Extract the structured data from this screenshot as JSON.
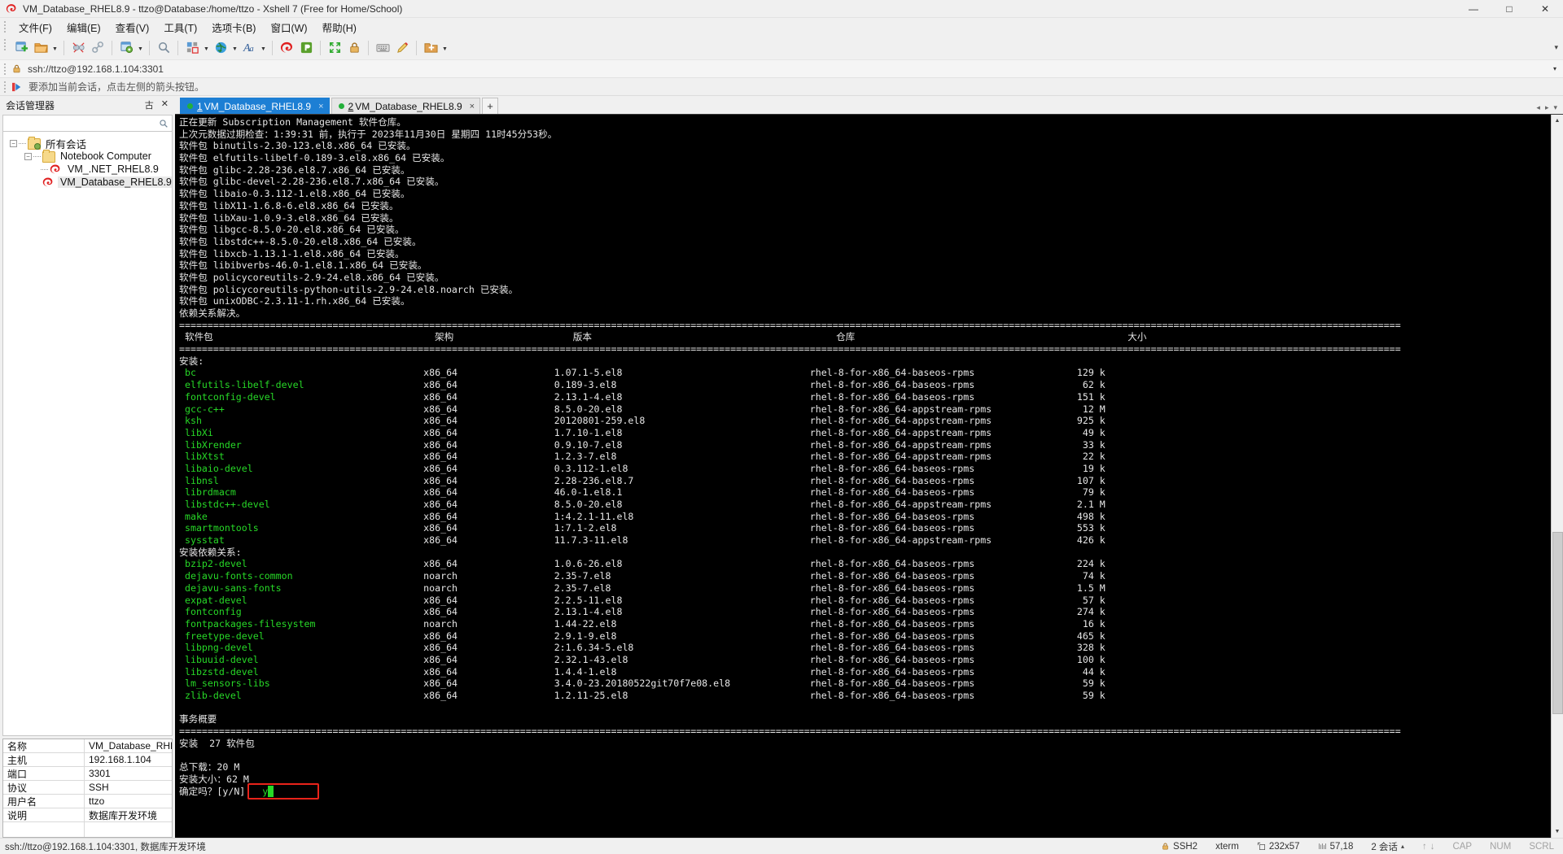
{
  "window": {
    "title": "VM_Database_RHEL8.9 - ttzo@Database:/home/ttzo - Xshell 7 (Free for Home/School)",
    "minimize": "—",
    "maximize": "□",
    "close": "✕"
  },
  "menu": {
    "items": [
      "文件(F)",
      "编辑(E)",
      "查看(V)",
      "工具(T)",
      "选项卡(B)",
      "窗口(W)",
      "帮助(H)"
    ]
  },
  "toolbar": {
    "items": [
      {
        "name": "new-session-icon"
      },
      {
        "name": "open-folder-icon",
        "caret": true
      },
      {
        "sep": true
      },
      {
        "name": "disconnect-icon"
      },
      {
        "name": "link-icon"
      },
      {
        "sep": true
      },
      {
        "name": "session-properties-icon",
        "caret": true
      },
      {
        "sep": true
      },
      {
        "name": "find-icon"
      },
      {
        "sep": true
      },
      {
        "name": "layout-icon",
        "caret": true
      },
      {
        "name": "globe-icon",
        "caret": true
      },
      {
        "name": "font-icon",
        "caret": true
      },
      {
        "sep": true
      },
      {
        "name": "xshell-icon"
      },
      {
        "name": "xftp-icon"
      },
      {
        "sep": true
      },
      {
        "name": "fullscreen-icon"
      },
      {
        "name": "lock-icon"
      },
      {
        "sep": true
      },
      {
        "name": "keyboard-icon"
      },
      {
        "name": "highlight-icon"
      },
      {
        "sep": true
      },
      {
        "name": "add-folder-icon",
        "caret": true
      }
    ],
    "overflow": "▾"
  },
  "address": {
    "lock_icon": "lock-icon",
    "url": "ssh://ttzo@192.168.1.104:3301",
    "dropdown": "▾"
  },
  "hint": {
    "icon": "red-arrow-icon",
    "text": "要添加当前会话，点击左侧的箭头按钮。"
  },
  "sidebar": {
    "title": "会话管理器",
    "pin_icon": "古",
    "close_icon": "✕",
    "search": {
      "value": "",
      "placeholder": ""
    },
    "tree": [
      {
        "label": "所有会话",
        "level": 0,
        "type": "folder-root",
        "expander": "−"
      },
      {
        "label": "Notebook Computer",
        "level": 1,
        "type": "folder",
        "expander": "−"
      },
      {
        "label": "VM_.NET_RHEL8.9",
        "level": 2,
        "type": "session",
        "expander": ""
      },
      {
        "label": "VM_Database_RHEL8.9",
        "level": 2,
        "type": "session",
        "expander": "",
        "selected": true
      }
    ],
    "properties": [
      {
        "key": "名称",
        "value": "VM_Database_RHE..."
      },
      {
        "key": "主机",
        "value": "192.168.1.104"
      },
      {
        "key": "端口",
        "value": "3301"
      },
      {
        "key": "协议",
        "value": "SSH"
      },
      {
        "key": "用户名",
        "value": "ttzo"
      },
      {
        "key": "说明",
        "value": "数据库开发环境"
      },
      {
        "key": "",
        "value": ""
      }
    ]
  },
  "tabs": {
    "items": [
      {
        "num": "1",
        "label": "VM_Database_RHEL8.9",
        "active": true,
        "close": "×"
      },
      {
        "num": "2",
        "label": "VM_Database_RHEL8.9",
        "active": false,
        "close": "×"
      }
    ],
    "add_label": "+",
    "nav_left": "◂",
    "nav_right": "▸",
    "nav_menu": "▾"
  },
  "terminal": {
    "header_lines": [
      "正在更新 Subscription Management 软件仓库。",
      "上次元数据过期检查：1:39:31 前，执行于 2023年11月30日 星期四 11时45分53秒。",
      "软件包 binutils-2.30-123.el8.x86_64 已安装。",
      "软件包 elfutils-libelf-0.189-3.el8.x86_64 已安装。",
      "软件包 glibc-2.28-236.el8.7.x86_64 已安装。",
      "软件包 glibc-devel-2.28-236.el8.7.x86_64 已安装。",
      "软件包 libaio-0.3.112-1.el8.x86_64 已安装。",
      "软件包 libX11-1.6.8-6.el8.x86_64 已安装。",
      "软件包 libXau-1.0.9-3.el8.x86_64 已安装。",
      "软件包 libgcc-8.5.0-20.el8.x86_64 已安装。",
      "软件包 libstdc++-8.5.0-20.el8.x86_64 已安装。",
      "软件包 libxcb-1.13.1-1.el8.x86_64 已安装。",
      "软件包 libibverbs-46.0-1.el8.1.x86_64 已安装。",
      "软件包 policycoreutils-2.9-24.el8.x86_64 已安装。",
      "软件包 policycoreutils-python-utils-2.9-24.el8.noarch 已安装。",
      "软件包 unixODBC-2.3.11-1.rh.x86_64 已安装。",
      "依赖关系解决。"
    ],
    "table_header": {
      "package": "软件包",
      "arch": "架构",
      "version": "版本",
      "repo": "仓库",
      "size": "大小"
    },
    "section_install": "安装:",
    "section_deps": "安装依赖关系:",
    "install_rows": [
      {
        "pkg": "bc",
        "arch": "x86_64",
        "ver": "1.07.1-5.el8",
        "repo": "rhel-8-for-x86_64-baseos-rpms",
        "size": "129 k"
      },
      {
        "pkg": "elfutils-libelf-devel",
        "arch": "x86_64",
        "ver": "0.189-3.el8",
        "repo": "rhel-8-for-x86_64-baseos-rpms",
        "size": "62 k"
      },
      {
        "pkg": "fontconfig-devel",
        "arch": "x86_64",
        "ver": "2.13.1-4.el8",
        "repo": "rhel-8-for-x86_64-baseos-rpms",
        "size": "151 k"
      },
      {
        "pkg": "gcc-c++",
        "arch": "x86_64",
        "ver": "8.5.0-20.el8",
        "repo": "rhel-8-for-x86_64-appstream-rpms",
        "size": "12 M"
      },
      {
        "pkg": "ksh",
        "arch": "x86_64",
        "ver": "20120801-259.el8",
        "repo": "rhel-8-for-x86_64-appstream-rpms",
        "size": "925 k"
      },
      {
        "pkg": "libXi",
        "arch": "x86_64",
        "ver": "1.7.10-1.el8",
        "repo": "rhel-8-for-x86_64-appstream-rpms",
        "size": "49 k"
      },
      {
        "pkg": "libXrender",
        "arch": "x86_64",
        "ver": "0.9.10-7.el8",
        "repo": "rhel-8-for-x86_64-appstream-rpms",
        "size": "33 k"
      },
      {
        "pkg": "libXtst",
        "arch": "x86_64",
        "ver": "1.2.3-7.el8",
        "repo": "rhel-8-for-x86_64-appstream-rpms",
        "size": "22 k"
      },
      {
        "pkg": "libaio-devel",
        "arch": "x86_64",
        "ver": "0.3.112-1.el8",
        "repo": "rhel-8-for-x86_64-baseos-rpms",
        "size": "19 k"
      },
      {
        "pkg": "libnsl",
        "arch": "x86_64",
        "ver": "2.28-236.el8.7",
        "repo": "rhel-8-for-x86_64-baseos-rpms",
        "size": "107 k"
      },
      {
        "pkg": "librdmacm",
        "arch": "x86_64",
        "ver": "46.0-1.el8.1",
        "repo": "rhel-8-for-x86_64-baseos-rpms",
        "size": "79 k"
      },
      {
        "pkg": "libstdc++-devel",
        "arch": "x86_64",
        "ver": "8.5.0-20.el8",
        "repo": "rhel-8-for-x86_64-appstream-rpms",
        "size": "2.1 M"
      },
      {
        "pkg": "make",
        "arch": "x86_64",
        "ver": "1:4.2.1-11.el8",
        "repo": "rhel-8-for-x86_64-baseos-rpms",
        "size": "498 k"
      },
      {
        "pkg": "smartmontools",
        "arch": "x86_64",
        "ver": "1:7.1-2.el8",
        "repo": "rhel-8-for-x86_64-baseos-rpms",
        "size": "553 k"
      },
      {
        "pkg": "sysstat",
        "arch": "x86_64",
        "ver": "11.7.3-11.el8",
        "repo": "rhel-8-for-x86_64-appstream-rpms",
        "size": "426 k"
      }
    ],
    "dep_rows": [
      {
        "pkg": "bzip2-devel",
        "arch": "x86_64",
        "ver": "1.0.6-26.el8",
        "repo": "rhel-8-for-x86_64-baseos-rpms",
        "size": "224 k"
      },
      {
        "pkg": "dejavu-fonts-common",
        "arch": "noarch",
        "ver": "2.35-7.el8",
        "repo": "rhel-8-for-x86_64-baseos-rpms",
        "size": "74 k"
      },
      {
        "pkg": "dejavu-sans-fonts",
        "arch": "noarch",
        "ver": "2.35-7.el8",
        "repo": "rhel-8-for-x86_64-baseos-rpms",
        "size": "1.5 M"
      },
      {
        "pkg": "expat-devel",
        "arch": "x86_64",
        "ver": "2.2.5-11.el8",
        "repo": "rhel-8-for-x86_64-baseos-rpms",
        "size": "57 k"
      },
      {
        "pkg": "fontconfig",
        "arch": "x86_64",
        "ver": "2.13.1-4.el8",
        "repo": "rhel-8-for-x86_64-baseos-rpms",
        "size": "274 k"
      },
      {
        "pkg": "fontpackages-filesystem",
        "arch": "noarch",
        "ver": "1.44-22.el8",
        "repo": "rhel-8-for-x86_64-baseos-rpms",
        "size": "16 k"
      },
      {
        "pkg": "freetype-devel",
        "arch": "x86_64",
        "ver": "2.9.1-9.el8",
        "repo": "rhel-8-for-x86_64-baseos-rpms",
        "size": "465 k"
      },
      {
        "pkg": "libpng-devel",
        "arch": "x86_64",
        "ver": "2:1.6.34-5.el8",
        "repo": "rhel-8-for-x86_64-baseos-rpms",
        "size": "328 k"
      },
      {
        "pkg": "libuuid-devel",
        "arch": "x86_64",
        "ver": "2.32.1-43.el8",
        "repo": "rhel-8-for-x86_64-baseos-rpms",
        "size": "100 k"
      },
      {
        "pkg": "libzstd-devel",
        "arch": "x86_64",
        "ver": "1.4.4-1.el8",
        "repo": "rhel-8-for-x86_64-baseos-rpms",
        "size": "44 k"
      },
      {
        "pkg": "lm_sensors-libs",
        "arch": "x86_64",
        "ver": "3.4.0-23.20180522git70f7e08.el8",
        "repo": "rhel-8-for-x86_64-baseos-rpms",
        "size": "59 k"
      },
      {
        "pkg": "zlib-devel",
        "arch": "x86_64",
        "ver": "1.2.11-25.el8",
        "repo": "rhel-8-for-x86_64-baseos-rpms",
        "size": "59 k"
      }
    ],
    "summary_title": "事务概要",
    "summary_install": "安装  27 软件包",
    "total_download": "总下载：20 M",
    "install_size": "安装大小：62 M",
    "prompt": "确定吗？[y/N]",
    "answer": "y",
    "highlight_color": "#e8231a"
  },
  "statusbar": {
    "left": "ssh://ttzo@192.168.1.104:3301, 数据库开发环境",
    "items": [
      {
        "name": "ssh-protocol",
        "icon": "lock-icon",
        "label": "SSH2"
      },
      {
        "name": "terminal-type",
        "icon": "",
        "label": "xterm"
      },
      {
        "name": "terminal-size",
        "icon": "resize-icon",
        "label": "232x57"
      },
      {
        "name": "cursor-position",
        "icon": "cursor-icon",
        "label": "57,18"
      },
      {
        "name": "session-count",
        "icon": "",
        "label": "2 会话"
      }
    ],
    "session_caret": "▴",
    "up_arrow": "↑",
    "down_arrow": "↓",
    "cap": "CAP",
    "num": "NUM",
    "scrl": "SCRL"
  }
}
